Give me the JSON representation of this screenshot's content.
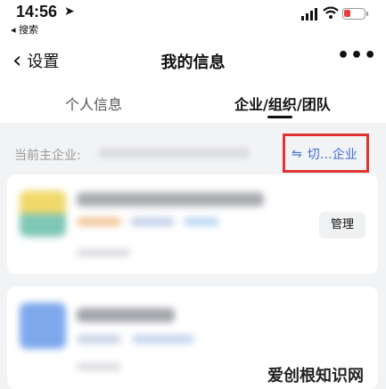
{
  "status_bar": {
    "time": "14:56",
    "back_app": "◂ 搜索"
  },
  "nav": {
    "back_label": "设置",
    "title": "我的信息",
    "more": "•••"
  },
  "tabs": [
    {
      "label": "个人信息",
      "active": false
    },
    {
      "label": "企业/组织/团队",
      "active": true
    }
  ],
  "current_enterprise": {
    "label": "当前主企业:",
    "switch_label": "切…企业"
  },
  "cards": [
    {
      "action_label": "管理"
    },
    {}
  ],
  "watermark": {
    "text": "爱创根知识网"
  },
  "colors": {
    "accent": "#3d6fd8",
    "highlight_box": "#e03434",
    "battery_low": "#e83b3b"
  }
}
